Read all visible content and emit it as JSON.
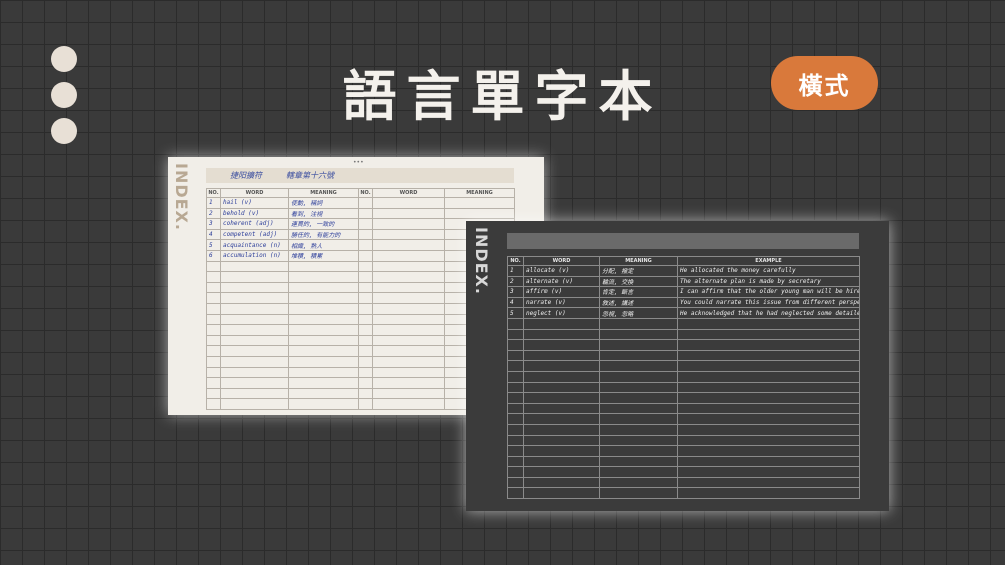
{
  "header": {
    "title": "語言單字本",
    "badge": "橫式"
  },
  "light_page": {
    "index_label": "INDEX.",
    "header_notes": [
      "捷阳擴符",
      "轄章第十六號"
    ],
    "columns": [
      "NO.",
      "WORD",
      "MEANING",
      "NO.",
      "WORD",
      "MEANING"
    ],
    "rows": [
      {
        "no": "1",
        "word": "hail      (v)",
        "meaning": "使動, 稱詞"
      },
      {
        "no": "2",
        "word": "behold    (v)",
        "meaning": "看到, 注視"
      },
      {
        "no": "3",
        "word": "coherent  (adj)",
        "meaning": "連貫的, 一致的"
      },
      {
        "no": "4",
        "word": "competent (adj)",
        "meaning": "勝任的, 有能力的"
      },
      {
        "no": "5",
        "word": "acquaintance (n)",
        "meaning": "相識, 熟人"
      },
      {
        "no": "6",
        "word": "accumulation (n)",
        "meaning": "堆積, 積累"
      }
    ]
  },
  "dark_page": {
    "index_label": "INDEX.",
    "columns": [
      "NO.",
      "WORD",
      "MEANING",
      "EXAMPLE"
    ],
    "rows": [
      {
        "no": "1",
        "word": "allocate   (v)",
        "meaning": "分配, 撥定",
        "example": "He allocated the money carefully"
      },
      {
        "no": "2",
        "word": "alternate  (v)",
        "meaning": "輪流, 交換",
        "example": "The alternate plan is made by secretary"
      },
      {
        "no": "3",
        "word": "affirm     (v)",
        "meaning": "肯定, 斷言",
        "example": "I can affirm that the older young man will be hired"
      },
      {
        "no": "4",
        "word": "narrate    (v)",
        "meaning": "敘述, 講述",
        "example": "You could narrate this issue from different perspectives"
      },
      {
        "no": "5",
        "word": "neglect    (v)",
        "meaning": "忽視, 忽略",
        "example": "He acknowledged that he had neglected some detailed issues"
      }
    ]
  }
}
